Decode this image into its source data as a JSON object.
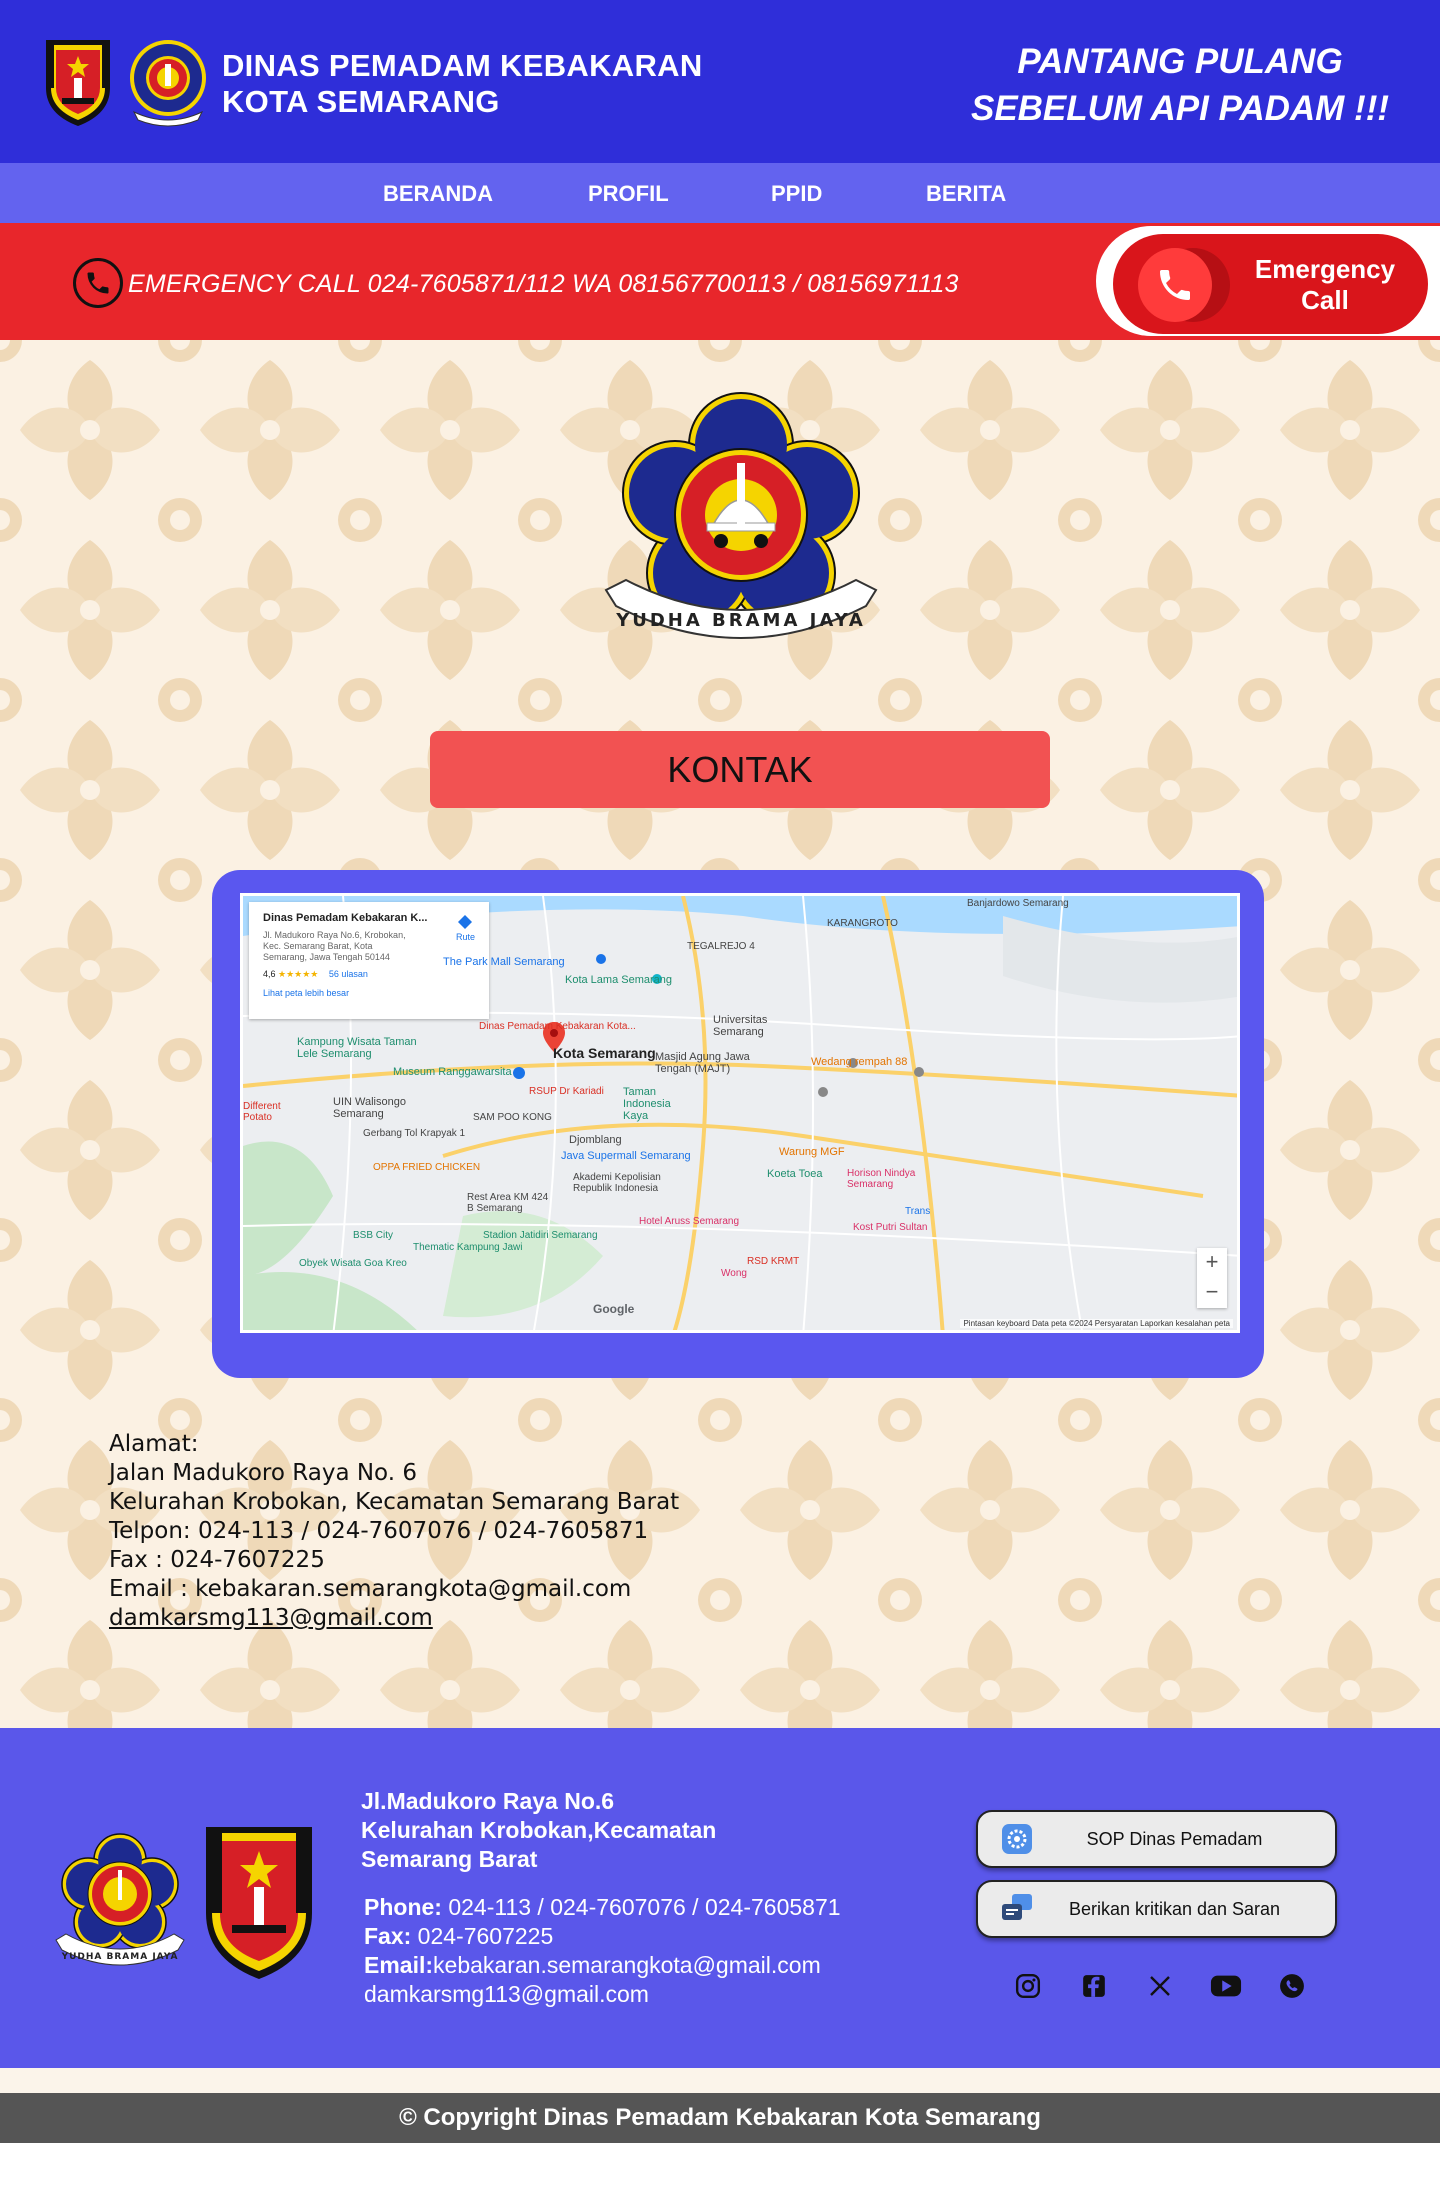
{
  "header": {
    "title_line1": "DINAS PEMADAM KEBAKARAN",
    "title_line2": "KOTA SEMARANG",
    "slogan_line1": "PANTANG PULANG",
    "slogan_line2": "SEBELUM API PADAM !!!",
    "logo_text": "YUDHA BRAMA JAYA",
    "colors": {
      "header": "#2f2ed9",
      "nav": "#6363ef",
      "emergency": "#e8262b"
    }
  },
  "nav": {
    "items": [
      "BERANDA",
      "PROFIL",
      "PPID",
      "BERITA"
    ]
  },
  "emergency": {
    "text": "EMERGENCY CALL 024-7605871/112 WA 081567700113 / 08156971113",
    "button_line1": "Emergency",
    "button_line2": "Call"
  },
  "main": {
    "logo_text": "YUDHA BRAMA JAYA",
    "heading": "KONTAK",
    "map": {
      "card_name": "Dinas Pemadam Kebakaran K...",
      "card_address": "Jl. Madukoro Raya No.6, Krobokan, Kec. Semarang Barat, Kota Semarang, Jawa Tengah 50144",
      "card_rating": "4,6",
      "card_stars": "★★★★★",
      "card_reviews": "56 ulasan",
      "card_more": "Lihat peta lebih besar",
      "card_route": "Rute",
      "labels": {
        "city": "Kota Semarang",
        "pin": "Dinas Pemadam Kebakaran Kota...",
        "paragon": "The Park Mall Semarang",
        "kotalama": "Kota Lama Semarang",
        "tegalrejo": "TEGALREJO 4",
        "karangroto": "KARANGROTO",
        "bandarharjo": "Banjardowo Semarang",
        "kampung": "Kampung Wisata Taman Lele Semarang",
        "museum": "Museum Ranggawarsita",
        "masjid": "Masjid Agung Jawa Tengah (MAJT)",
        "unisula": "Universitas Semarang",
        "wedang": "Wedang rempah 88",
        "uin": "UIN Walisongo Semarang",
        "rsup": "RSUP Dr Kariadi",
        "taman": "Taman Indonesia Kaya",
        "sampookong": "SAM POO KONG",
        "gerbang": "Gerbang Tol Krapyak 1",
        "djomblang": "Djomblang",
        "supermall": "Java Supermall Semarang",
        "warung": "Warung MGF",
        "oppa": "OPPA FRIED CHICKEN",
        "akpol": "Akademi Kepolisian Republik Indonesia",
        "koeta": "Koeta Toea",
        "horison": "Horison Nindya Semarang",
        "rest": "Rest Area KM 424 B Semarang",
        "aruss": "Hotel Aruss Semarang",
        "trans": "Trans",
        "bsb": "BSB City",
        "jatidiri": "Stadion Jatidiri Semarang",
        "kostput": "Kost Putri Sultan",
        "thematic": "Thematic Kampung Jawi",
        "goakreo": "Obyek Wisata Goa Kreo",
        "rsd": "RSD KRMT",
        "wong": "Wong",
        "different": "Different Potato"
      },
      "google": "Google",
      "attribution": "Pintasan keyboard   Data peta ©2024   Persyaratan   Laporkan kesalahan peta",
      "zoom_in": "+",
      "zoom_out": "−"
    },
    "address": {
      "l1": "Alamat:",
      "l2": "Jalan Madukoro Raya No. 6",
      "l3": "Kelurahan Krobokan, Kecamatan Semarang Barat",
      "l4": "Telpon:  024-113 / 024-7607076 / 024-7605871",
      "l5": "Fax : 024-7607225",
      "l6": "Email :  kebakaran.semarangkota@gmail.com",
      "l7": "damkarsmg113@gmail.com"
    }
  },
  "footer": {
    "addr1": "Jl.Madukoro Raya No.6",
    "addr2": "Kelurahan Krobokan,Kecamatan",
    "addr3": "Semarang Barat",
    "phone_label": "Phone:",
    "phone": " 024-113 / 024-7607076 / 024-7605871",
    "fax_label": "Fax:",
    "fax": " 024-7607225",
    "email_label": "Email:",
    "email": "kebakaran.semarangkota@gmail.com",
    "email2": "damkarsmg113@gmail.com",
    "btn_sop": "SOP Dinas Pemadam",
    "btn_saran": "Berikan kritikan dan Saran",
    "socials": [
      "instagram-icon",
      "facebook-icon",
      "x-icon",
      "youtube-icon",
      "whatsapp-icon"
    ],
    "copyright": "© Copyright Dinas Pemadam Kebakaran Kota Semarang"
  }
}
